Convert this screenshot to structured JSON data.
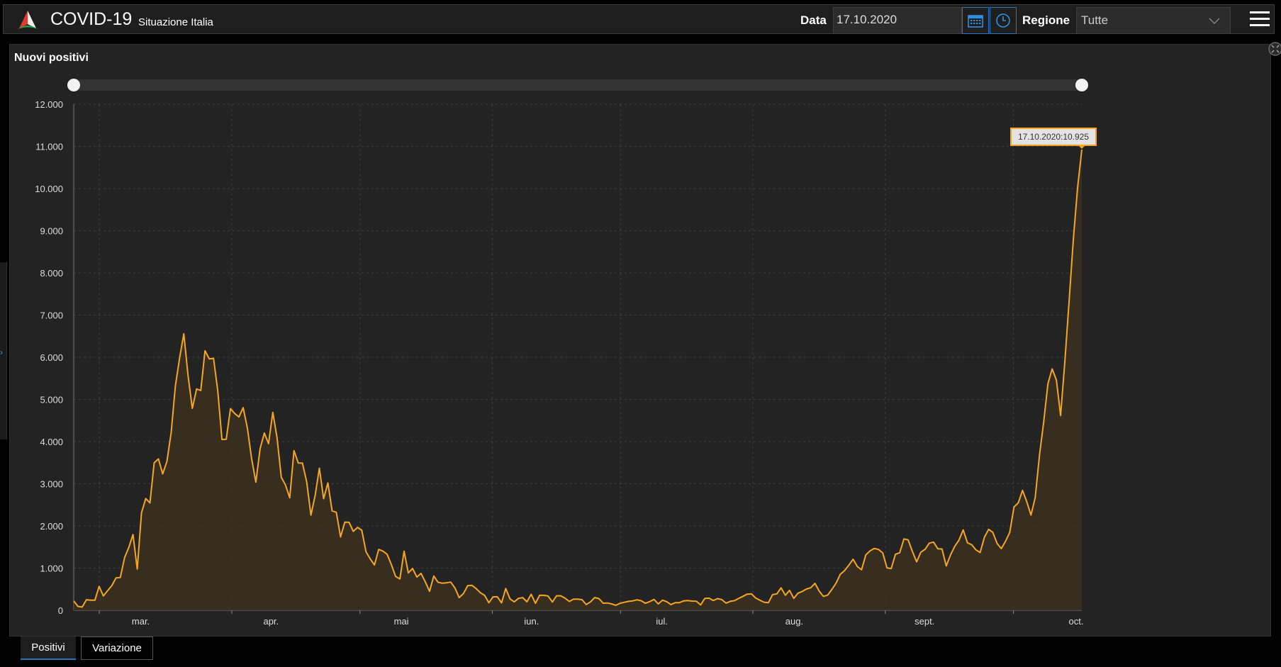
{
  "header": {
    "title": "COVID-19",
    "subtitle": "Situazione Italia",
    "date_label": "Data",
    "date_value": "17.10.2020",
    "region_label": "Regione",
    "region_value": "Tutte",
    "icons": [
      "logo-icon",
      "calendar-icon",
      "clock-icon",
      "chevron-down-icon",
      "menu-icon"
    ]
  },
  "panel": {
    "title": "Nuovi positivi"
  },
  "tabs": [
    {
      "label": "Positivi",
      "active": true
    },
    {
      "label": "Variazione",
      "active": false
    }
  ],
  "chart_data": {
    "type": "area",
    "title": "Nuovi positivi",
    "ylim": [
      0,
      12000
    ],
    "yticks": [
      "0",
      "1.000",
      "2.000",
      "3.000",
      "4.000",
      "5.000",
      "6.000",
      "7.000",
      "8.000",
      "9.000",
      "10.000",
      "11.000",
      "12.000"
    ],
    "xticks": [
      {
        "label": "mar.",
        "date": "2020-03-01"
      },
      {
        "label": "apr.",
        "date": "2020-04-01"
      },
      {
        "label": "mai",
        "date": "2020-05-01"
      },
      {
        "label": "iun.",
        "date": "2020-06-01"
      },
      {
        "label": "iul.",
        "date": "2020-07-01"
      },
      {
        "label": "aug.",
        "date": "2020-08-01"
      },
      {
        "label": "sept.",
        "date": "2020-09-01"
      },
      {
        "label": "oct.",
        "date": "2020-10-01"
      }
    ],
    "x_start": "2020-02-24",
    "x_end": "2020-10-17",
    "line_color": "#f5a623",
    "fill_color": "#3b3020",
    "grid": true,
    "tooltip": "17.10.2020:10.925",
    "series": [
      {
        "values": [
          221,
          93,
          78,
          250,
          238,
          240,
          566,
          342,
          466,
          587,
          769,
          778,
          1247,
          1492,
          1797,
          977,
          2313,
          2651,
          2547,
          3497,
          3590,
          3233,
          3526,
          4207,
          5322,
          5986,
          6557,
          5560,
          4789,
          5249,
          5210,
          6153,
          5959,
          5974,
          5217,
          4050,
          4053,
          4782,
          4668,
          4585,
          4805,
          4316,
          3599,
          3039,
          3836,
          4204,
          3951,
          4694,
          4092,
          3153,
          2972,
          2667,
          3786,
          3493,
          3491,
          3047,
          2256,
          2729,
          3370,
          2646,
          3021,
          2357,
          2324,
          1739,
          2091,
          2086,
          1872,
          1965,
          1900,
          1389,
          1221,
          1075,
          1444,
          1402,
          1327,
          1083,
          802,
          744,
          1402,
          888,
          992,
          789,
          875,
          675,
          451,
          813,
          665,
          642,
          652,
          669,
          531,
          300,
          397,
          584,
          593,
          516,
          416,
          355,
          178,
          318,
          321,
          177,
          518,
          270,
          200,
          283,
          300,
          202,
          379,
          167,
          357,
          355,
          338,
          197,
          345,
          343,
          288,
          210,
          264,
          265,
          252,
          136,
          199,
          303,
          278,
          168,
          173,
          152,
          120,
          166,
          190,
          211,
          223,
          248,
          225,
          167,
          207,
          259,
          152,
          240,
          204,
          136,
          180,
          181,
          224,
          232,
          219,
          215,
          128,
          280,
          287,
          232,
          277,
          254,
          170,
          211,
          229,
          283,
          331,
          383,
          389,
          293,
          238,
          192,
          180,
          372,
          390,
          532,
          356,
          474,
          282,
          406,
          447,
          504,
          534,
          638,
          453,
          329,
          360,
          495,
          648,
          856,
          941,
          1072,
          1210,
          1040,
          961,
          1315,
          1410,
          1467,
          1444,
          1360,
          1006,
          989,
          1328,
          1364,
          1693,
          1671,
          1397,
          1150,
          1380,
          1445,
          1593,
          1616,
          1458,
          1453,
          1052,
          1315,
          1518,
          1663,
          1907,
          1600,
          1555,
          1434,
          1369,
          1733,
          1920,
          1847,
          1587,
          1462,
          1640,
          1850,
          2452,
          2548,
          2844,
          2578,
          2257,
          2676,
          3678,
          4458,
          5372,
          5724,
          5456,
          4619,
          5901,
          7332,
          8804,
          10010,
          10925
        ]
      }
    ]
  }
}
